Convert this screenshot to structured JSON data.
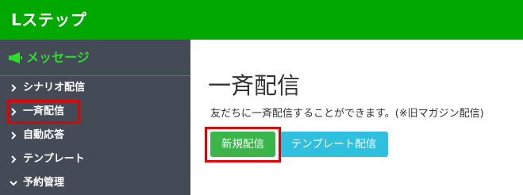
{
  "header": {
    "app_title": "Lステップ"
  },
  "sidebar": {
    "section_label": "メッセージ",
    "items": [
      {
        "label": "シナリオ配信",
        "icon": "chevron-right-icon"
      },
      {
        "label": "一斉配信",
        "icon": "chevron-right-icon",
        "highlighted": true
      },
      {
        "label": "自動応答",
        "icon": "chevron-right-icon"
      },
      {
        "label": "テンプレート",
        "icon": "chevron-right-icon"
      },
      {
        "label": "予約管理",
        "icon": "chevron-down-icon"
      }
    ]
  },
  "main": {
    "title": "一斉配信",
    "description": "友だちに一斉配信することができます。(※旧マガジン配信)",
    "buttons": {
      "new_label": "新規配信",
      "template_label": "テンプレート配信"
    }
  },
  "colors": {
    "header_bg": "#00a800",
    "sidebar_bg": "#454b56",
    "accent_green": "#2edc2e",
    "new_button": "#39b54a",
    "template_button": "#2fc0e0",
    "highlight_red": "#e30000"
  }
}
